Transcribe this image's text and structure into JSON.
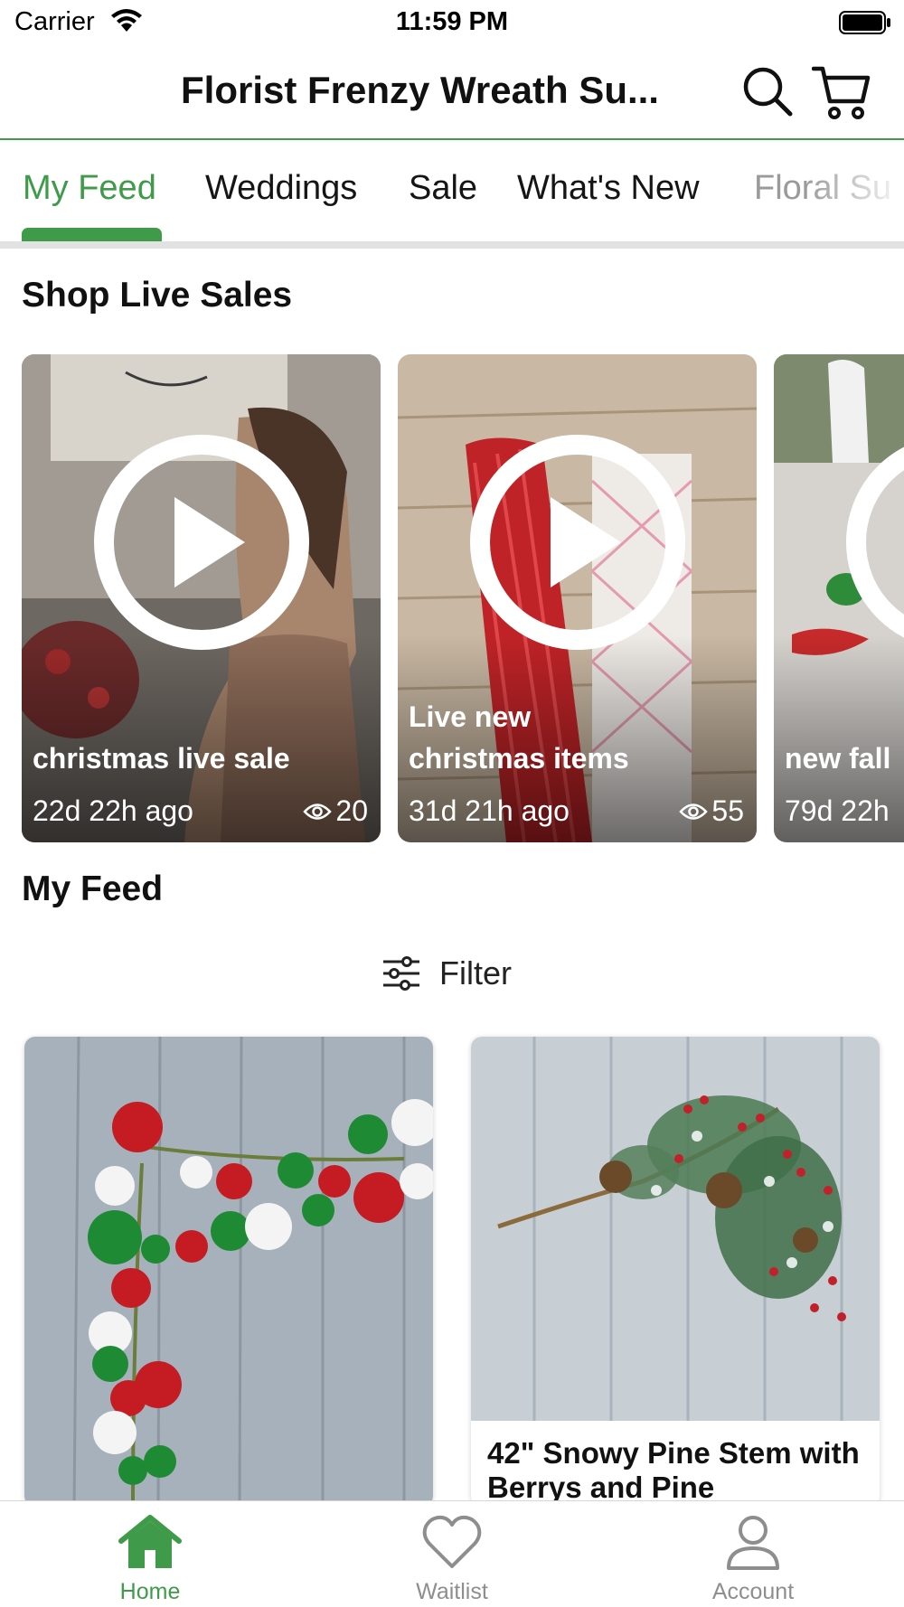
{
  "status_bar": {
    "carrier": "Carrier",
    "time": "11:59 PM"
  },
  "header": {
    "title": "Florist Frenzy Wreath Su..."
  },
  "tabs": [
    {
      "label": "My Feed",
      "active": true
    },
    {
      "label": "Weddings",
      "active": false
    },
    {
      "label": "Sale",
      "active": false
    },
    {
      "label": "What's New",
      "active": false
    },
    {
      "label": "Floral Su",
      "active": false
    }
  ],
  "live_section": {
    "title": "Shop Live Sales",
    "cards": [
      {
        "title": "christmas live sale",
        "ago": "22d 22h ago",
        "views": "20"
      },
      {
        "title": "Live new christmas items",
        "ago": "31d 21h ago",
        "views": "55"
      },
      {
        "title": "new fall",
        "ago": "79d 22h",
        "views": ""
      }
    ]
  },
  "feed_section": {
    "title": "My Feed",
    "filter_label": "Filter"
  },
  "products": [
    {
      "name": ""
    },
    {
      "name": "42\" Snowy Pine Stem with Berrys and Pine"
    }
  ],
  "bottom_nav": [
    {
      "label": "Home",
      "icon": "home-icon",
      "active": true
    },
    {
      "label": "Waitlist",
      "icon": "heart-icon",
      "active": false
    },
    {
      "label": "Account",
      "icon": "person-icon",
      "active": false
    }
  ],
  "colors": {
    "accent": "#3f9b4a",
    "tab_track": "#e2e2e2",
    "nav_inactive": "#8e8e8e"
  }
}
